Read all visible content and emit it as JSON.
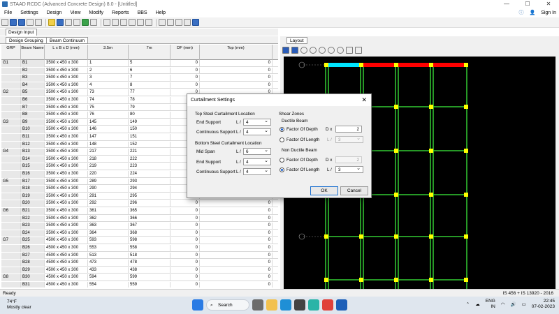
{
  "window": {
    "title": "STAAD RCDC (Advanced Concrete Design) 8.0 - [Untitled]",
    "min": "—",
    "max": "☐",
    "close": "✕"
  },
  "menu": {
    "items": [
      "File",
      "Settings",
      "Design",
      "View",
      "Modify",
      "Reports",
      "BBS",
      "Help"
    ],
    "sign_in": "Sign In"
  },
  "left_tabs": {
    "design_input": "Design Input"
  },
  "sub_tabs": {
    "grouping": "Design Grouping",
    "continuum": "Beam Continuum"
  },
  "grid": {
    "headers": [
      "GRP",
      "Beam Name",
      "L x B x D (mm)",
      "3.5m",
      "7m",
      "DF (mm)",
      "Top (mm)"
    ],
    "rows": [
      [
        "G1",
        "B1",
        "3500 x 450 x 300",
        "1",
        "5",
        "0",
        "0"
      ],
      [
        "",
        "B2",
        "3500 x 450 x 300",
        "2",
        "6",
        "0",
        "0"
      ],
      [
        "",
        "B3",
        "3500 x 450 x 300",
        "3",
        "7",
        "0",
        "0"
      ],
      [
        "",
        "B4",
        "3500 x 450 x 300",
        "4",
        "8",
        "0",
        "0"
      ],
      [
        "G2",
        "B5",
        "3500 x 450 x 300",
        "73",
        "77",
        "0",
        "0"
      ],
      [
        "",
        "B6",
        "3500 x 450 x 300",
        "74",
        "78",
        "",
        ""
      ],
      [
        "",
        "B7",
        "3500 x 450 x 300",
        "75",
        "79",
        "",
        ""
      ],
      [
        "",
        "B8",
        "3500 x 450 x 300",
        "76",
        "80",
        "",
        ""
      ],
      [
        "G3",
        "B9",
        "3500 x 450 x 300",
        "145",
        "149",
        "",
        ""
      ],
      [
        "",
        "B10",
        "3500 x 450 x 300",
        "146",
        "150",
        "",
        ""
      ],
      [
        "",
        "B11",
        "3500 x 450 x 300",
        "147",
        "151",
        "",
        ""
      ],
      [
        "",
        "B12",
        "3500 x 450 x 300",
        "148",
        "152",
        "",
        ""
      ],
      [
        "G4",
        "B13",
        "3500 x 450 x 300",
        "217",
        "221",
        "",
        ""
      ],
      [
        "",
        "B14",
        "3500 x 450 x 300",
        "218",
        "222",
        "",
        ""
      ],
      [
        "",
        "B15",
        "3500 x 450 x 300",
        "219",
        "223",
        "",
        ""
      ],
      [
        "",
        "B16",
        "3500 x 450 x 300",
        "220",
        "224",
        "",
        ""
      ],
      [
        "G5",
        "B17",
        "3500 x 450 x 300",
        "289",
        "293",
        "",
        ""
      ],
      [
        "",
        "B18",
        "3500 x 450 x 300",
        "290",
        "294",
        "",
        ""
      ],
      [
        "",
        "B19",
        "3500 x 450 x 300",
        "291",
        "295",
        "0",
        "0"
      ],
      [
        "",
        "B20",
        "3500 x 450 x 300",
        "292",
        "296",
        "0",
        "0"
      ],
      [
        "G6",
        "B21",
        "3500 x 450 x 300",
        "361",
        "365",
        "0",
        "0"
      ],
      [
        "",
        "B22",
        "3500 x 450 x 300",
        "362",
        "366",
        "0",
        "0"
      ],
      [
        "",
        "B23",
        "3500 x 450 x 300",
        "363",
        "367",
        "0",
        "0"
      ],
      [
        "",
        "B24",
        "3500 x 450 x 300",
        "364",
        "368",
        "0",
        "0"
      ],
      [
        "G7",
        "B25",
        "4500 x 450 x 300",
        "593",
        "598",
        "0",
        "0"
      ],
      [
        "",
        "B26",
        "4500 x 450 x 300",
        "553",
        "558",
        "0",
        "0"
      ],
      [
        "",
        "B27",
        "4500 x 450 x 300",
        "513",
        "518",
        "0",
        "0"
      ],
      [
        "",
        "B28",
        "4500 x 450 x 300",
        "473",
        "478",
        "0",
        "0"
      ],
      [
        "",
        "B29",
        "4500 x 450 x 300",
        "433",
        "438",
        "0",
        "0"
      ],
      [
        "G8",
        "B30",
        "4500 x 450 x 300",
        "594",
        "599",
        "0",
        "0"
      ],
      [
        "",
        "B31",
        "4500 x 450 x 300",
        "554",
        "559",
        "0",
        "0"
      ]
    ]
  },
  "layout": {
    "tab": "Layout"
  },
  "dialog": {
    "title": "Curtailment Settings",
    "close": "✕",
    "top_section": "Top Steel Curtailment Location",
    "end_support": "End Support",
    "continuous_support": "Continuous Support",
    "l_prefix": "L /",
    "top_end_val": "4",
    "top_cont_val": "4",
    "bottom_section": "Bottom Steel Curtailment Location",
    "mid_span": "Mid Span",
    "bot_mid_val": "6",
    "bot_end_val": "4",
    "bot_cont_val": "4",
    "shear_zones": "Shear Zones",
    "ductile_beam": "Ductile Beam",
    "factor_depth": "Factor Of Depth",
    "factor_length": "Factor Of Length",
    "d_prefix": "D x",
    "ductile_depth_val": "2",
    "ductile_length_val": "3",
    "non_ductile_beam": "Non Ductile Beam",
    "nd_depth_val": "2",
    "nd_length_val": "3",
    "ok": "OK",
    "cancel": "Cancel"
  },
  "status": {
    "left": "Ready",
    "right": "IS 456 + IS 13920 - 2016"
  },
  "taskbar": {
    "temp": "74°F",
    "weather": "Mostly clear",
    "search": "Search",
    "lang1": "ENG",
    "lang2": "IN",
    "time": "22:45",
    "date": "07-02-2023"
  },
  "colors": {
    "beam_red": "#ff0000",
    "beam_cyan": "#00e5ff",
    "frame_green": "#33cc33",
    "node_yellow": "#ffff00"
  }
}
